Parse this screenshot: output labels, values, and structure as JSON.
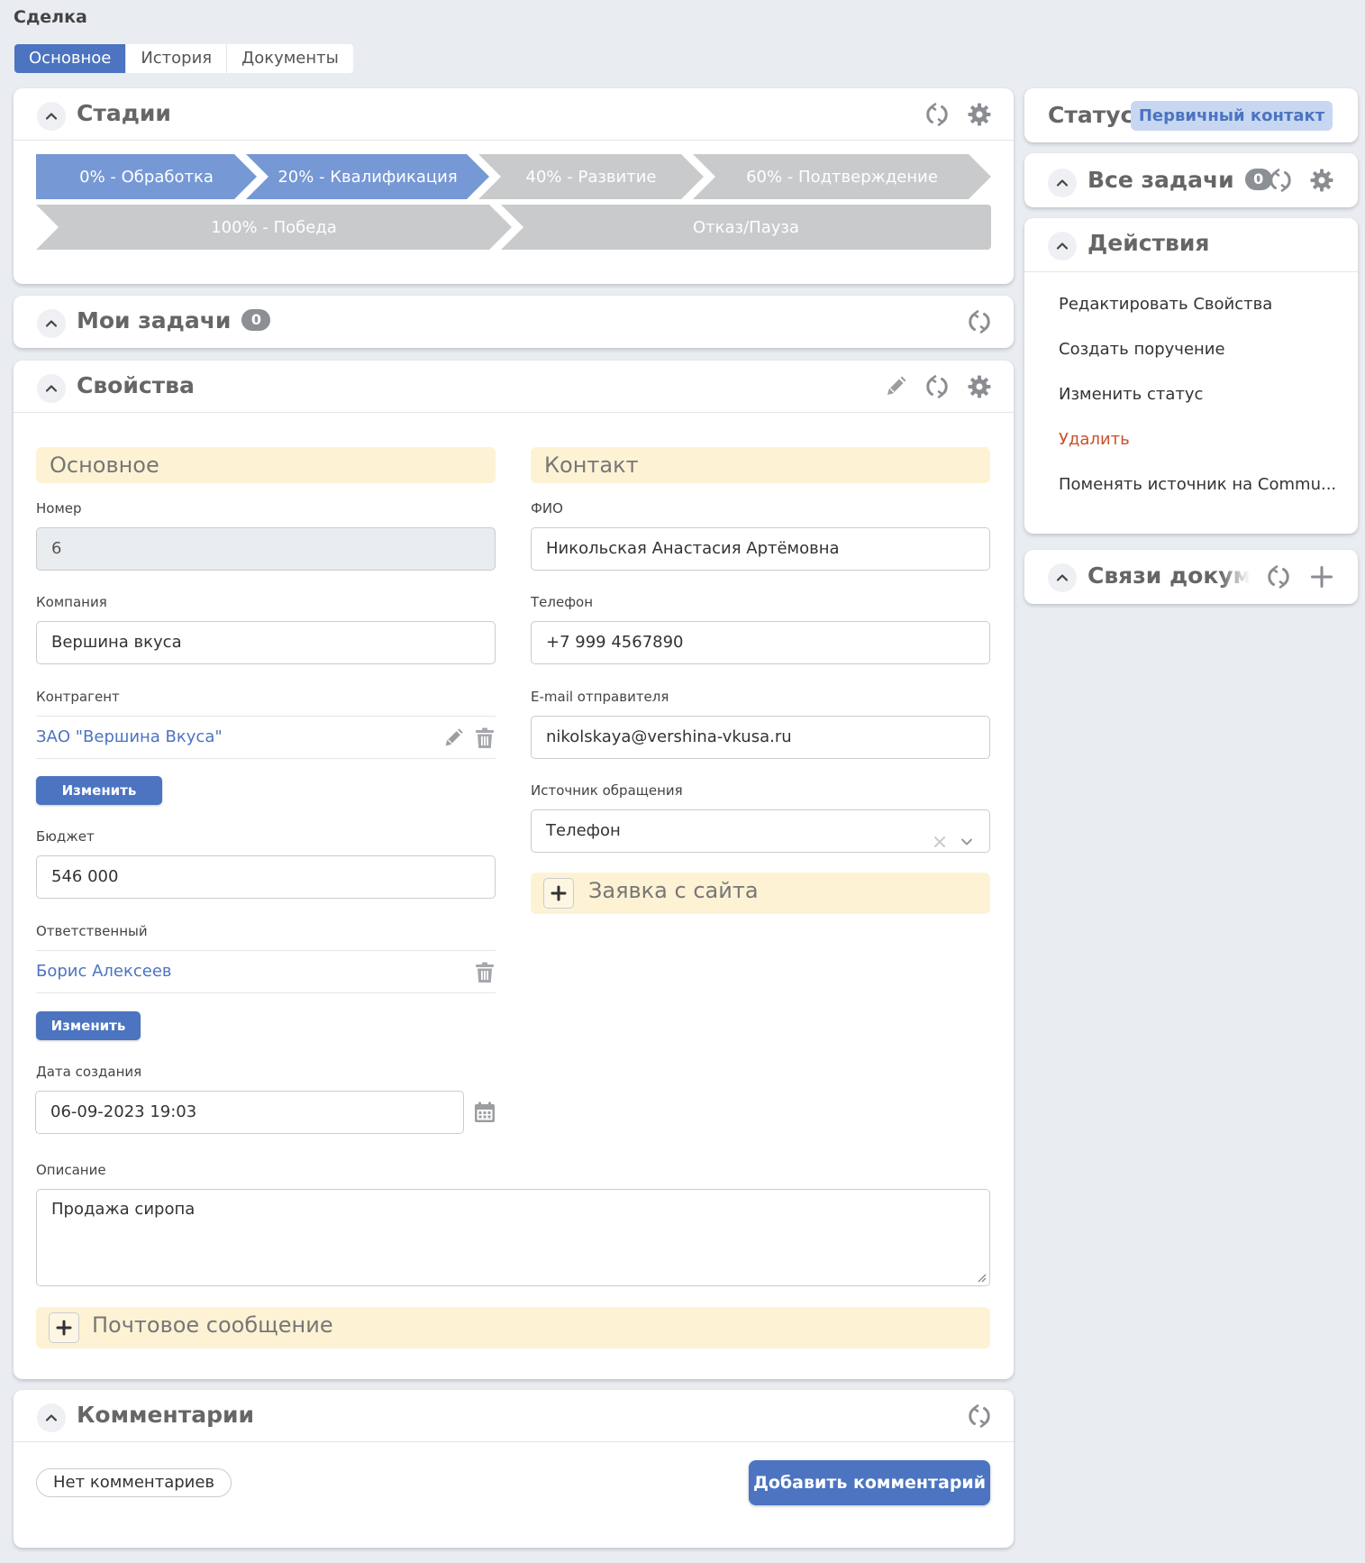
{
  "page": {
    "title": "Сделка"
  },
  "tabs": [
    {
      "label": "Основное",
      "active": true
    },
    {
      "label": "История",
      "active": false
    },
    {
      "label": "Документы",
      "active": false
    }
  ],
  "stages": {
    "title": "Стадии",
    "items": [
      {
        "label": "0% - Обработка",
        "state": "done"
      },
      {
        "label": "20% - Квалификация",
        "state": "current"
      },
      {
        "label": "40% - Развитие",
        "state": "pending"
      },
      {
        "label": "60% - Подтверждение",
        "state": "pending"
      },
      {
        "label": "100% - Победа",
        "state": "pending"
      },
      {
        "label": "Отказ/Пауза",
        "state": "pending"
      }
    ]
  },
  "my_tasks": {
    "title": "Мои задачи",
    "count": "0"
  },
  "properties": {
    "title": "Свойства",
    "main_section": "Основное",
    "contact_section": "Контакт",
    "number_label": "Номер",
    "number_value": "6",
    "company_label": "Компания",
    "company_value": "Вершина вкуса",
    "counterparty_label": "Контрагент",
    "counterparty_value": "ЗАО \"Вершина Вкуса\"",
    "change_label": "Изменить",
    "budget_label": "Бюджет",
    "budget_value": "546 000",
    "responsible_label": "Ответственный",
    "responsible_value": "Борис Алексеев",
    "created_label": "Дата создания",
    "created_value": "06-09-2023 19:03",
    "fio_label": "ФИО",
    "fio_value": "Никольская Анастасия Артёмовна",
    "phone_label": "Телефон",
    "phone_value": "+7 999 4567890",
    "email_label": "E-mail отправителя",
    "email_value": "nikolskaya@vershina-vkusa.ru",
    "source_label": "Источник обращения",
    "source_value": "Телефон",
    "site_request": "Заявка с сайта",
    "description_label": "Описание",
    "description_value": "Продажа сиропа",
    "mail_message": "Почтовое сообщение"
  },
  "comments": {
    "title": "Комментарии",
    "empty": "Нет комментариев",
    "add_button": "Добавить комментарий"
  },
  "status": {
    "label": "Статус",
    "value": "Первичный контакт"
  },
  "all_tasks": {
    "title": "Все задачи",
    "count": "0"
  },
  "actions": {
    "title": "Действия",
    "items": [
      "Редактировать Свойства",
      "Создать поручение",
      "Изменить статус",
      "Удалить",
      "Поменять источник на Commu..."
    ]
  },
  "doc_links": {
    "title": "Связи докумен"
  },
  "colors": {
    "accent": "#4c74c0",
    "stage_active": "#7698d4",
    "stage_inactive": "#c9cacc",
    "section_band": "#fdf3d4",
    "danger": "#c9502a"
  }
}
